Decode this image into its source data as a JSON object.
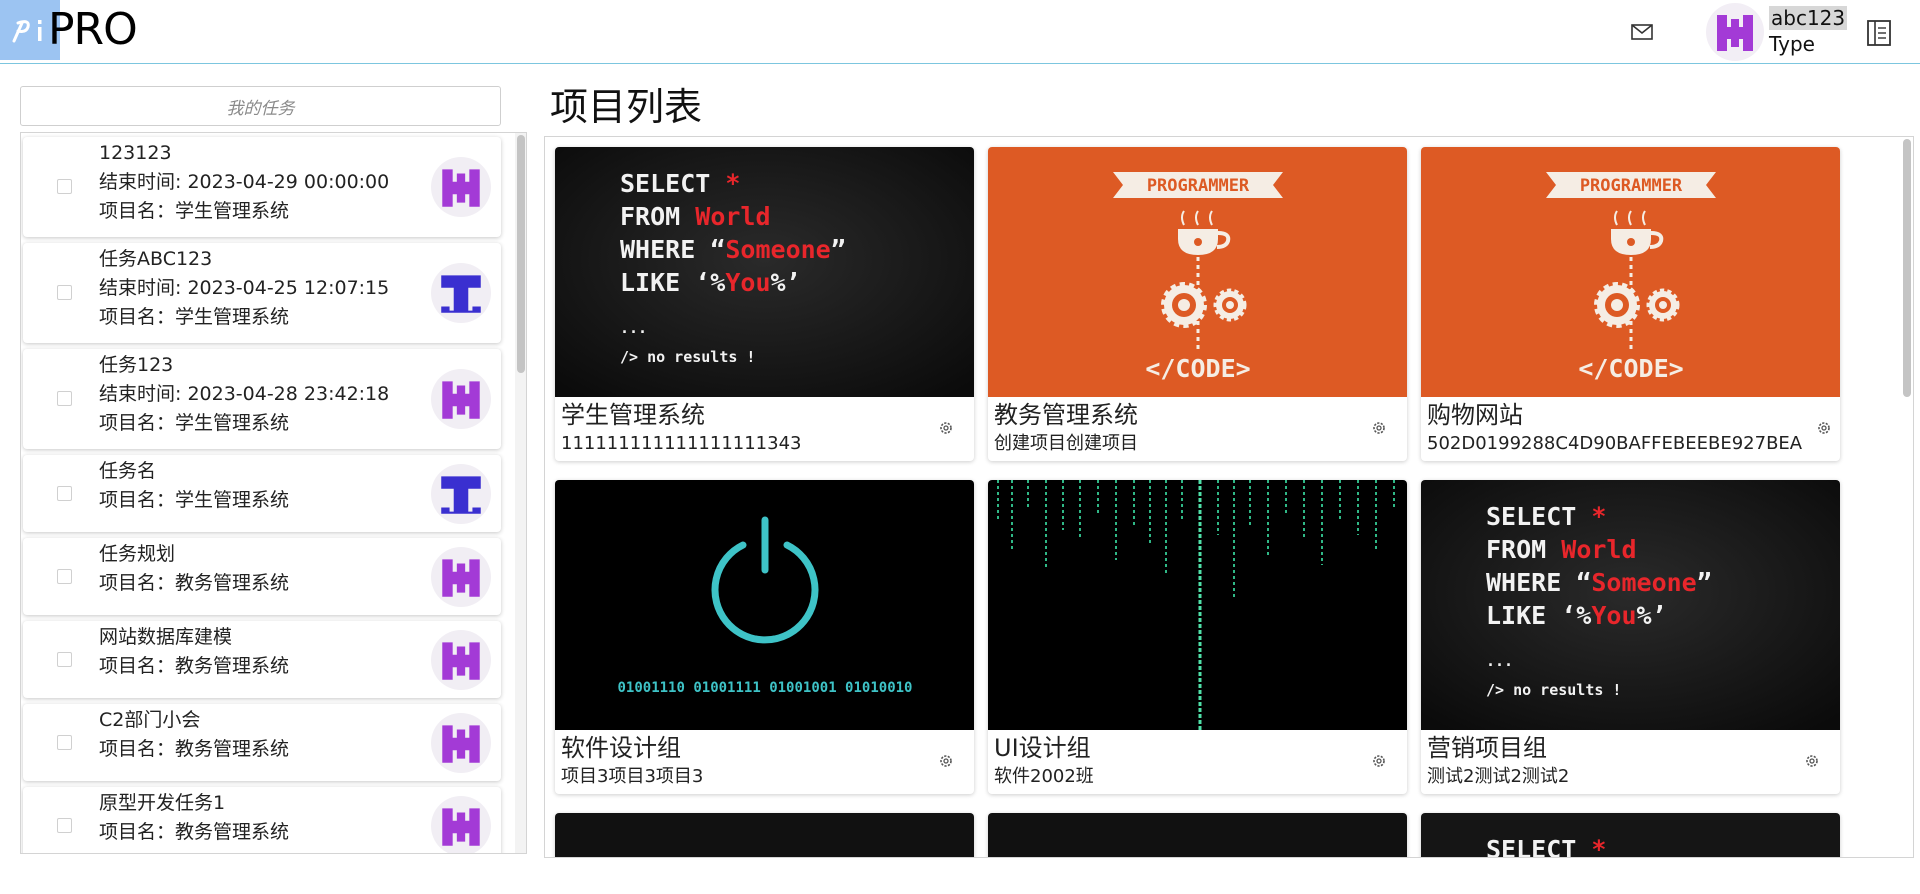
{
  "app": {
    "logo_text": "PRO"
  },
  "user": {
    "name": "abc123",
    "type": "Type"
  },
  "tasks": {
    "search_placeholder": "我的任务",
    "items": [
      {
        "title": "123123",
        "end_time": "结束时间: 2023-04-29 00:00:00",
        "project": "项目名：学生管理系统",
        "avatar": "purple-h"
      },
      {
        "title": "任务ABC123",
        "end_time": "结束时间: 2023-04-25 12:07:15",
        "project": "项目名：学生管理系统",
        "avatar": "blue-t"
      },
      {
        "title": "任务123",
        "end_time": "结束时间: 2023-04-28 23:42:18",
        "project": "项目名：学生管理系统",
        "avatar": "purple-h"
      },
      {
        "title": "任务名",
        "project": "项目名：学生管理系统",
        "avatar": "blue-t"
      },
      {
        "title": "任务规划",
        "project": "项目名：教务管理系统",
        "avatar": "purple-h"
      },
      {
        "title": "网站数据库建模",
        "project": "项目名：教务管理系统",
        "avatar": "purple-h"
      },
      {
        "title": "C2部门小会",
        "project": "项目名：教务管理系统",
        "avatar": "purple-h"
      },
      {
        "title": "原型开发任务1",
        "project": "项目名：教务管理系统",
        "avatar": "purple-h"
      }
    ]
  },
  "projects": {
    "title": "项目列表",
    "items": [
      {
        "name": "学生管理系统",
        "description": "111111111111111111343",
        "cover": "sql"
      },
      {
        "name": "教务管理系统",
        "description": "创建项目创建项目",
        "cover": "programmer"
      },
      {
        "name": "购物网站",
        "description": "502D0199288C4D90BAFFEBEEBE927BEA",
        "cover": "programmer"
      },
      {
        "name": "软件设计组",
        "description": "项目3项目3项目3",
        "cover": "power"
      },
      {
        "name": "UI设计组",
        "description": "软件2002班",
        "cover": "matrix"
      },
      {
        "name": "营销项目组",
        "description": "测试2测试2测试2",
        "cover": "sql"
      }
    ]
  },
  "covers": {
    "sql": {
      "line1_a": "SELECT",
      "line1_b": "*",
      "line2_a": "FROM",
      "line2_b": "World",
      "line3_a": "WHERE “",
      "line3_b": "Someone",
      "line3_c": "”",
      "line4_a": "LIKE ‘%",
      "line4_b": "You",
      "line4_c": "%’",
      "dots": "...",
      "result": "/> no results !"
    },
    "programmer": {
      "banner": "PROGRAMMER",
      "code": "</CODE>"
    },
    "power": {
      "binary": "01001110 01001111 01001001 01010010"
    }
  },
  "colors": {
    "accent_line": "#7cc6df",
    "avatar_purple": "#a33ad6",
    "avatar_blue": "#3a2fd0",
    "orange": "#dd5a24"
  }
}
